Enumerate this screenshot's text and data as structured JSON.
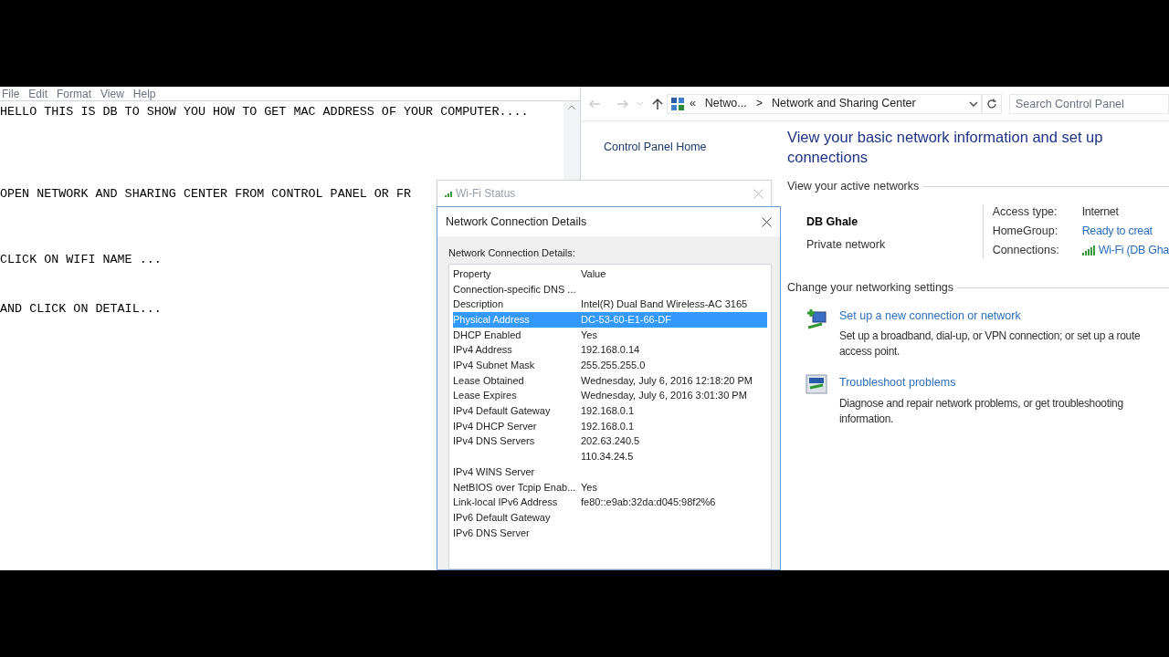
{
  "notepad": {
    "menu": [
      "File",
      "Edit",
      "Format",
      "View",
      "Help"
    ],
    "lines": [
      "HELLO THIS IS DB TO SHOW YOU HOW TO GET MAC ADDRESS OF YOUR COMPUTER....",
      "OPEN NETWORK AND SHARING CENTER FROM CONTROL PANEL OR FR",
      "CLICK ON WIFI NAME ...",
      "AND CLICK ON DETAIL..."
    ]
  },
  "control_panel": {
    "breadcrumb": [
      "«",
      "Netwo...",
      ">",
      "Network and Sharing Center"
    ],
    "search": {
      "placeholder": "Search Control Panel"
    },
    "nav": [
      "Control Panel Home"
    ],
    "heading": "View your basic network information and set up connections",
    "active_networks_label": "View your active networks",
    "network": {
      "name": "DB Ghale",
      "type": "Private network"
    },
    "properties": [
      {
        "label": "Access type:",
        "value": "Internet",
        "kind": "plain"
      },
      {
        "label": "HomeGroup:",
        "value": "Ready to creat",
        "kind": "link"
      },
      {
        "label": "Connections:",
        "value": "Wi-Fi (DB Gha",
        "kind": "wifi"
      }
    ],
    "settings_label": "Change your networking settings",
    "tasks": [
      {
        "kind": "setup",
        "title": "Set up a new connection or network",
        "description_lines": [
          "Set up a broadband, dial-up, or VPN connection; or set up a route",
          "access point."
        ]
      },
      {
        "kind": "troubleshoot",
        "title": "Troubleshoot problems",
        "description_lines": [
          "Diagnose and repair network problems, or get troubleshooting",
          "information."
        ]
      }
    ]
  },
  "wifi_status": {
    "title": "Wi-Fi Status"
  },
  "details_dialog": {
    "title": "Network Connection Details",
    "caption": "Network Connection Details:",
    "columns": [
      "Property",
      "Value"
    ],
    "rows": [
      {
        "property": "Connection-specific DNS ...",
        "selected": false
      },
      {
        "property": "Description",
        "value": "Intel(R) Dual Band Wireless-AC 3165",
        "selected": false
      },
      {
        "property": "Physical Address",
        "value": "DC-53-60-E1-66-DF",
        "selected": true
      },
      {
        "property": "DHCP Enabled",
        "value": "Yes",
        "selected": false
      },
      {
        "property": "IPv4 Address",
        "value": "192.168.0.14",
        "selected": false
      },
      {
        "property": "IPv4 Subnet Mask",
        "value": "255.255.255.0",
        "selected": false
      },
      {
        "property": "Lease Obtained",
        "value": "Wednesday, July 6, 2016 12:18:20 PM",
        "selected": false
      },
      {
        "property": "Lease Expires",
        "value": "Wednesday, July 6, 2016 3:01:30 PM",
        "selected": false
      },
      {
        "property": "IPv4 Default Gateway",
        "value": "192.168.0.1",
        "selected": false
      },
      {
        "property": "IPv4 DHCP Server",
        "value": "192.168.0.1",
        "selected": false
      },
      {
        "property": "IPv4 DNS Servers",
        "value": "202.63.240.5",
        "selected": false
      },
      {
        "value": "110.34.24.5",
        "selected": false
      },
      {
        "property": "IPv4 WINS Server",
        "selected": false
      },
      {
        "property": "NetBIOS over Tcpip Enab...",
        "value": "Yes",
        "selected": false
      },
      {
        "property": "Link-local IPv6 Address",
        "value": "fe80::e9ab:32da:d045:98f2%6",
        "selected": false
      },
      {
        "property": "IPv6 Default Gateway",
        "selected": false
      },
      {
        "property": "IPv6 DNS Server",
        "selected": false
      }
    ]
  }
}
